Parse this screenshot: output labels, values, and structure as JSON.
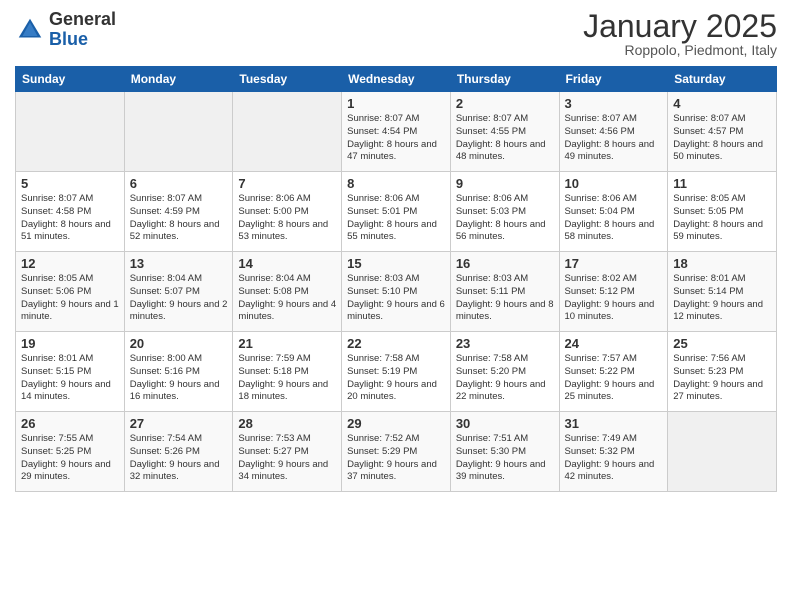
{
  "logo": {
    "general": "General",
    "blue": "Blue"
  },
  "header": {
    "month": "January 2025",
    "location": "Roppolo, Piedmont, Italy"
  },
  "weekdays": [
    "Sunday",
    "Monday",
    "Tuesday",
    "Wednesday",
    "Thursday",
    "Friday",
    "Saturday"
  ],
  "weeks": [
    [
      {
        "day": "",
        "empty": true
      },
      {
        "day": "",
        "empty": true
      },
      {
        "day": "",
        "empty": true
      },
      {
        "day": "1",
        "sunrise": "8:07 AM",
        "sunset": "4:54 PM",
        "daylight": "8 hours and 47 minutes."
      },
      {
        "day": "2",
        "sunrise": "8:07 AM",
        "sunset": "4:55 PM",
        "daylight": "8 hours and 48 minutes."
      },
      {
        "day": "3",
        "sunrise": "8:07 AM",
        "sunset": "4:56 PM",
        "daylight": "8 hours and 49 minutes."
      },
      {
        "day": "4",
        "sunrise": "8:07 AM",
        "sunset": "4:57 PM",
        "daylight": "8 hours and 50 minutes."
      }
    ],
    [
      {
        "day": "5",
        "sunrise": "8:07 AM",
        "sunset": "4:58 PM",
        "daylight": "8 hours and 51 minutes."
      },
      {
        "day": "6",
        "sunrise": "8:07 AM",
        "sunset": "4:59 PM",
        "daylight": "8 hours and 52 minutes."
      },
      {
        "day": "7",
        "sunrise": "8:06 AM",
        "sunset": "5:00 PM",
        "daylight": "8 hours and 53 minutes."
      },
      {
        "day": "8",
        "sunrise": "8:06 AM",
        "sunset": "5:01 PM",
        "daylight": "8 hours and 55 minutes."
      },
      {
        "day": "9",
        "sunrise": "8:06 AM",
        "sunset": "5:03 PM",
        "daylight": "8 hours and 56 minutes."
      },
      {
        "day": "10",
        "sunrise": "8:06 AM",
        "sunset": "5:04 PM",
        "daylight": "8 hours and 58 minutes."
      },
      {
        "day": "11",
        "sunrise": "8:05 AM",
        "sunset": "5:05 PM",
        "daylight": "8 hours and 59 minutes."
      }
    ],
    [
      {
        "day": "12",
        "sunrise": "8:05 AM",
        "sunset": "5:06 PM",
        "daylight": "9 hours and 1 minute."
      },
      {
        "day": "13",
        "sunrise": "8:04 AM",
        "sunset": "5:07 PM",
        "daylight": "9 hours and 2 minutes."
      },
      {
        "day": "14",
        "sunrise": "8:04 AM",
        "sunset": "5:08 PM",
        "daylight": "9 hours and 4 minutes."
      },
      {
        "day": "15",
        "sunrise": "8:03 AM",
        "sunset": "5:10 PM",
        "daylight": "9 hours and 6 minutes."
      },
      {
        "day": "16",
        "sunrise": "8:03 AM",
        "sunset": "5:11 PM",
        "daylight": "9 hours and 8 minutes."
      },
      {
        "day": "17",
        "sunrise": "8:02 AM",
        "sunset": "5:12 PM",
        "daylight": "9 hours and 10 minutes."
      },
      {
        "day": "18",
        "sunrise": "8:01 AM",
        "sunset": "5:14 PM",
        "daylight": "9 hours and 12 minutes."
      }
    ],
    [
      {
        "day": "19",
        "sunrise": "8:01 AM",
        "sunset": "5:15 PM",
        "daylight": "9 hours and 14 minutes."
      },
      {
        "day": "20",
        "sunrise": "8:00 AM",
        "sunset": "5:16 PM",
        "daylight": "9 hours and 16 minutes."
      },
      {
        "day": "21",
        "sunrise": "7:59 AM",
        "sunset": "5:18 PM",
        "daylight": "9 hours and 18 minutes."
      },
      {
        "day": "22",
        "sunrise": "7:58 AM",
        "sunset": "5:19 PM",
        "daylight": "9 hours and 20 minutes."
      },
      {
        "day": "23",
        "sunrise": "7:58 AM",
        "sunset": "5:20 PM",
        "daylight": "9 hours and 22 minutes."
      },
      {
        "day": "24",
        "sunrise": "7:57 AM",
        "sunset": "5:22 PM",
        "daylight": "9 hours and 25 minutes."
      },
      {
        "day": "25",
        "sunrise": "7:56 AM",
        "sunset": "5:23 PM",
        "daylight": "9 hours and 27 minutes."
      }
    ],
    [
      {
        "day": "26",
        "sunrise": "7:55 AM",
        "sunset": "5:25 PM",
        "daylight": "9 hours and 29 minutes."
      },
      {
        "day": "27",
        "sunrise": "7:54 AM",
        "sunset": "5:26 PM",
        "daylight": "9 hours and 32 minutes."
      },
      {
        "day": "28",
        "sunrise": "7:53 AM",
        "sunset": "5:27 PM",
        "daylight": "9 hours and 34 minutes."
      },
      {
        "day": "29",
        "sunrise": "7:52 AM",
        "sunset": "5:29 PM",
        "daylight": "9 hours and 37 minutes."
      },
      {
        "day": "30",
        "sunrise": "7:51 AM",
        "sunset": "5:30 PM",
        "daylight": "9 hours and 39 minutes."
      },
      {
        "day": "31",
        "sunrise": "7:49 AM",
        "sunset": "5:32 PM",
        "daylight": "9 hours and 42 minutes."
      },
      {
        "day": "",
        "empty": true
      }
    ]
  ]
}
